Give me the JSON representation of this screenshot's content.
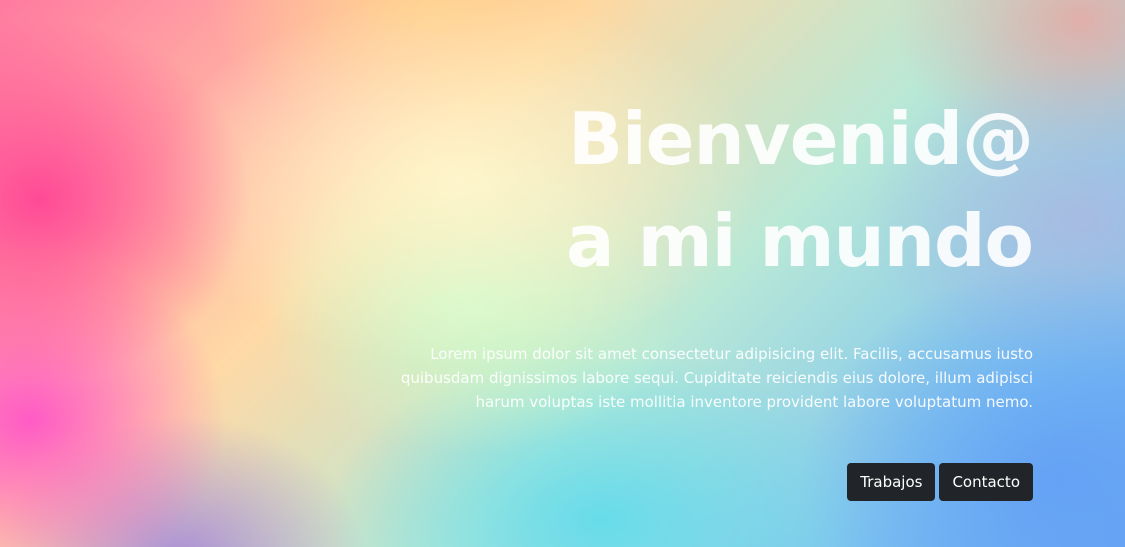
{
  "hero": {
    "title_line1": "Bienvenid@",
    "title_line2": "a mi mundo",
    "description": "Lorem ipsum dolor sit amet consectetur adipisicing elit. Facilis, accusamus iusto quibusdam dignissimos labore sequi. Cupiditate reiciendis eius dolore, illum adipisci harum voluptas iste mollitia inventore provident labore voluptatum nemo.",
    "buttons": {
      "trabajos": "Trabajos",
      "contacto": "Contacto"
    }
  },
  "colors": {
    "button_bg": "#212529",
    "button_text": "#ffffff",
    "title_text": "#ffffff"
  }
}
